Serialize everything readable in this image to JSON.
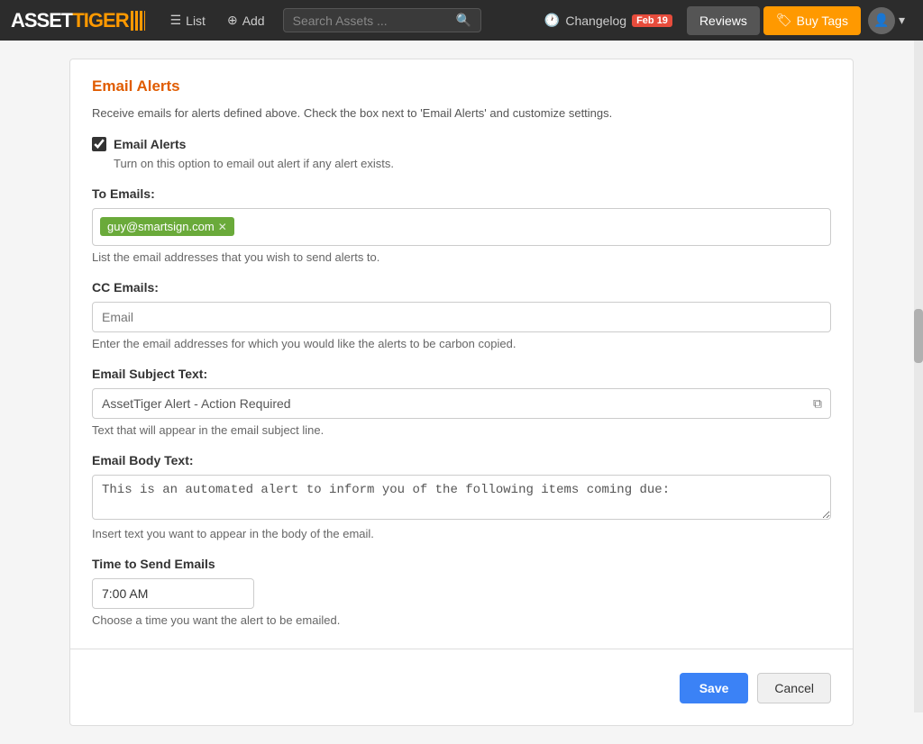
{
  "navbar": {
    "logo_asset": "ASSET",
    "logo_tiger": "TIGER",
    "list_label": "List",
    "add_label": "Add",
    "search_placeholder": "Search Assets ...",
    "changelog_label": "Changelog",
    "changelog_badge": "Feb 19",
    "reviews_label": "Reviews",
    "buy_tags_label": "Buy Tags"
  },
  "section": {
    "title": "Email Alerts",
    "description": "Receive emails for alerts defined above. Check the box next to 'Email Alerts' and customize settings.",
    "checkbox_label": "Email Alerts",
    "checkbox_hint": "Turn on this option to email out alert if any alert exists.",
    "to_emails_label": "To Emails:",
    "to_emails_tag": "guy@smartsign.com",
    "to_emails_hint": "List the email addresses that you wish to send alerts to.",
    "cc_emails_label": "CC Emails:",
    "cc_emails_placeholder": "Email",
    "cc_emails_hint": "Enter the email addresses for which you would like the alerts to be carbon copied.",
    "subject_label": "Email Subject Text:",
    "subject_value": "AssetTiger Alert - Action Required",
    "subject_hint": "Text that will appear in the email subject line.",
    "body_label": "Email Body Text:",
    "body_value": "This is an automated alert to inform you of the following items coming due:",
    "body_hint": "Insert text you want to appear in the body of the email.",
    "time_label": "Time to Send Emails",
    "time_value": "7:00 AM",
    "time_hint": "Choose a time you want the alert to be emailed.",
    "save_label": "Save",
    "cancel_label": "Cancel"
  }
}
